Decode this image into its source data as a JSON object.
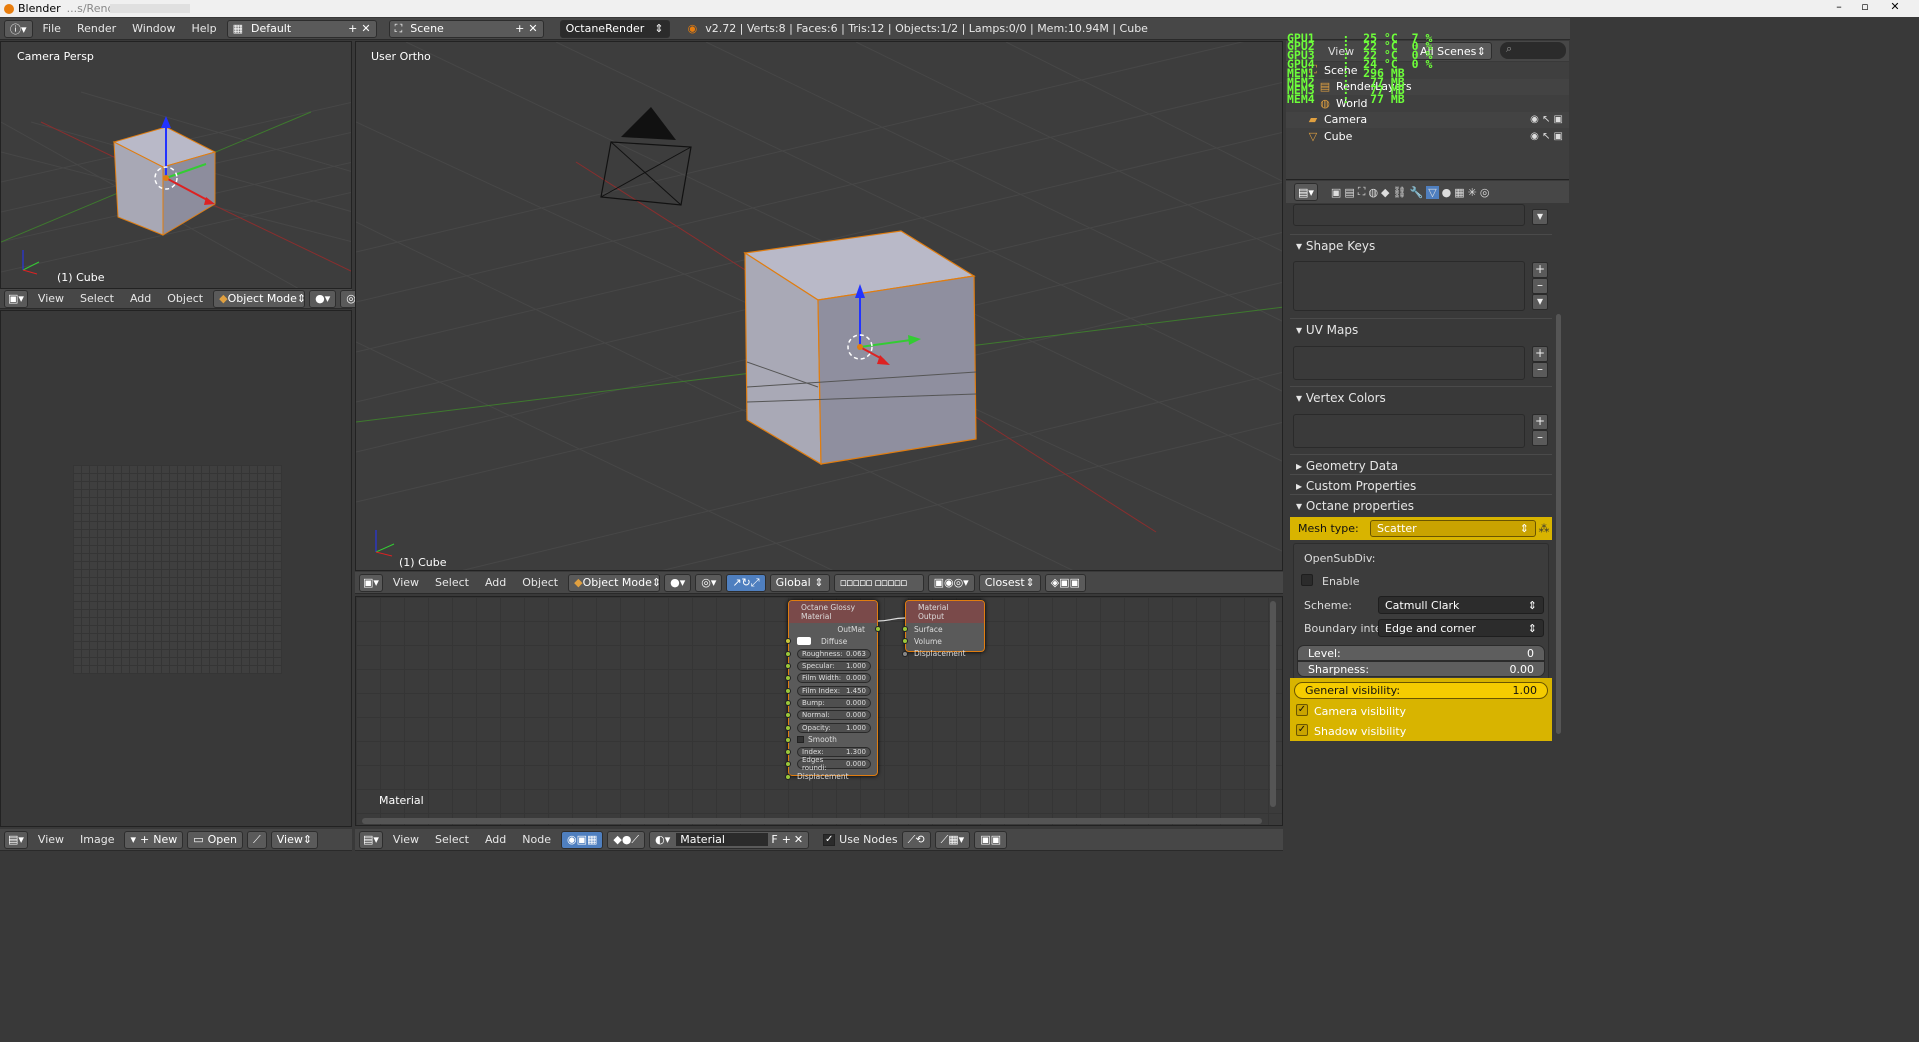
{
  "window": {
    "title": "Blender",
    "title_suffix": "...s/Render Presets..."
  },
  "menubar": {
    "items": [
      "File",
      "Render",
      "Window",
      "Help"
    ],
    "layout": "Default",
    "scene": "Scene",
    "engine": "OctaneRender",
    "stats": "v2.72 | Verts:8 | Faces:6 | Tris:12 | Objects:1/2 | Lamps:0/0 | Mem:10.94M | Cube"
  },
  "gpu_overlay": [
    "GPU1    :  25 °C  7 %",
    "GPU2    :  22 °C  0 %",
    "GPU3    :  22 °C  0 %",
    "GPU4    :  24 °C  0 %",
    "MEM1    :  296 MB",
    "MEM2    :   77 MB",
    "MEM3    :   77 MB",
    "MEM4    :   77 MB"
  ],
  "outliner": {
    "view_label": "View",
    "search_label": "Search",
    "all_scenes": "All Scenes",
    "items": [
      {
        "name": "Scene",
        "icon": "scene-icon"
      },
      {
        "name": "RenderLayers",
        "icon": "render-layers-icon"
      },
      {
        "name": "World",
        "icon": "world-icon"
      },
      {
        "name": "Camera",
        "icon": "camera-icon"
      },
      {
        "name": "Cube",
        "icon": "mesh-icon"
      }
    ]
  },
  "viewport_small": {
    "label": "Camera Persp",
    "object": "(1) Cube"
  },
  "viewport_main": {
    "label": "User Ortho",
    "object": "(1) Cube"
  },
  "small_header": {
    "items": [
      "View",
      "Select",
      "Add",
      "Object"
    ],
    "mode": "Object Mode"
  },
  "main_header": {
    "items": [
      "View",
      "Select",
      "Add",
      "Object"
    ],
    "mode": "Object Mode",
    "orientation": "Global",
    "snap": "Closest"
  },
  "image_header": {
    "items": [
      "View",
      "Image"
    ],
    "new": "New",
    "open": "Open",
    "view": "View"
  },
  "node_header": {
    "items": [
      "View",
      "Select",
      "Add",
      "Node"
    ],
    "material": "Material",
    "fake": "F",
    "use_nodes": "Use Nodes"
  },
  "node_editor": {
    "label": "Material",
    "glossy": {
      "title": "Octane Glossy Material",
      "output": "OutMat",
      "diffuse": "Diffuse",
      "fields": [
        {
          "name": "Roughness:",
          "value": "0.063"
        },
        {
          "name": "Specular:",
          "value": "1.000"
        },
        {
          "name": "Film Width:",
          "value": "0.000"
        },
        {
          "name": "Film Index:",
          "value": "1.450"
        },
        {
          "name": "Bump:",
          "value": "0.000"
        },
        {
          "name": "Normal:",
          "value": "0.000"
        },
        {
          "name": "Opacity:",
          "value": "1.000"
        }
      ],
      "smooth": "Smooth",
      "fields2": [
        {
          "name": "Index:",
          "value": "1.300"
        },
        {
          "name": "Edges roundi:",
          "value": "0.000"
        }
      ],
      "displacement": "Displacement"
    },
    "output": {
      "title": "Material Output",
      "inputs": [
        "Surface",
        "Volume",
        "Displacement"
      ]
    }
  },
  "properties": {
    "sections": {
      "shape_keys": "Shape Keys",
      "uv_maps": "UV Maps",
      "vertex_colors": "Vertex Colors",
      "geometry_data": "Geometry Data",
      "custom_properties": "Custom Properties",
      "octane_properties": "Octane properties"
    },
    "mesh_type_label": "Mesh type:",
    "mesh_type_value": "Scatter",
    "opensubdiv": "OpenSubDiv:",
    "enable": "Enable",
    "scheme_label": "Scheme:",
    "scheme_value": "Catmull Clark",
    "boundary_label": "Boundary interp.:",
    "boundary_value": "Edge and corner",
    "level_label": "Level:",
    "level_value": "0",
    "sharpness_label": "Sharpness:",
    "sharpness_value": "0.00",
    "general_vis_label": "General visibility:",
    "general_vis_value": "1.00",
    "camera_vis": "Camera visibility",
    "shadow_vis": "Shadow visibility"
  },
  "colors": {
    "accent_yellow": "#d8b400",
    "selection_orange": "#e07d10",
    "gpu_green": "#6dff3a"
  }
}
